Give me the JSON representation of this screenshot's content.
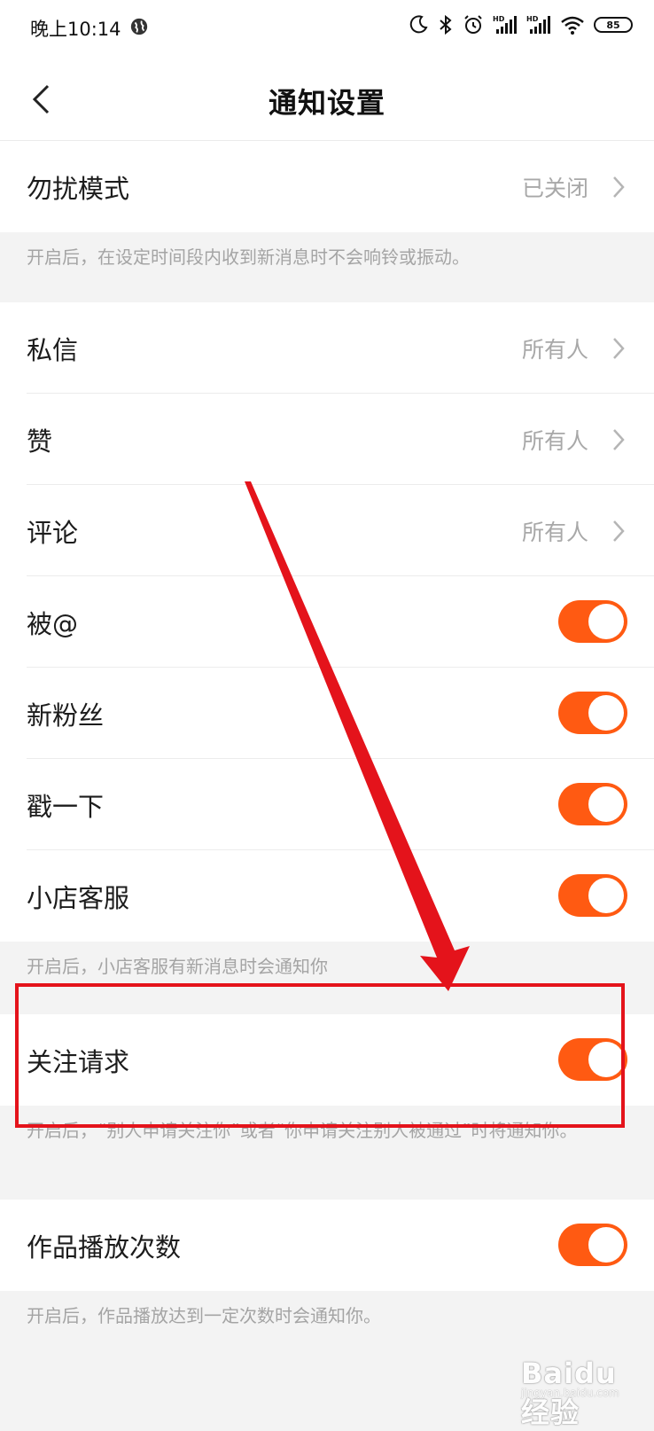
{
  "status_bar": {
    "time": "晚上10:14",
    "battery": "85",
    "icons": [
      "globe-icon",
      "moon-icon",
      "bluetooth-icon",
      "alarm-icon",
      "signal-hd-icon",
      "signal-hd-icon",
      "wifi-icon",
      "battery-icon"
    ]
  },
  "nav": {
    "title": "通知设置",
    "back_icon": "back-chevron-icon"
  },
  "dnd": {
    "label": "勿扰模式",
    "value": "已关闭",
    "note": "开启后，在设定时间段内收到新消息时不会响铃或振动。"
  },
  "messages": [
    {
      "label": "私信",
      "value": "所有人"
    },
    {
      "label": "赞",
      "value": "所有人"
    },
    {
      "label": "评论",
      "value": "所有人"
    }
  ],
  "toggles": [
    {
      "label": "被@",
      "on": true
    },
    {
      "label": "新粉丝",
      "on": true
    },
    {
      "label": "戳一下",
      "on": true
    },
    {
      "label": "小店客服",
      "on": true
    }
  ],
  "shop_note": "开启后，小店客服有新消息时会通知你",
  "follow_request": {
    "label": "关注请求",
    "on": true,
    "note": "开启后，“别人申请关注你”或者“你申请关注别人被通过”时将通知你。"
  },
  "play_count": {
    "label": "作品播放次数",
    "on": true,
    "note": "开启后，作品播放达到一定次数时会通知你。"
  },
  "colors": {
    "accent": "#ff5a12",
    "annotation": "#e4131b",
    "muted_text": "#a8a8a8"
  },
  "watermark": {
    "text": "Baidu经验",
    "sub": "jingyan.baidu.com"
  }
}
